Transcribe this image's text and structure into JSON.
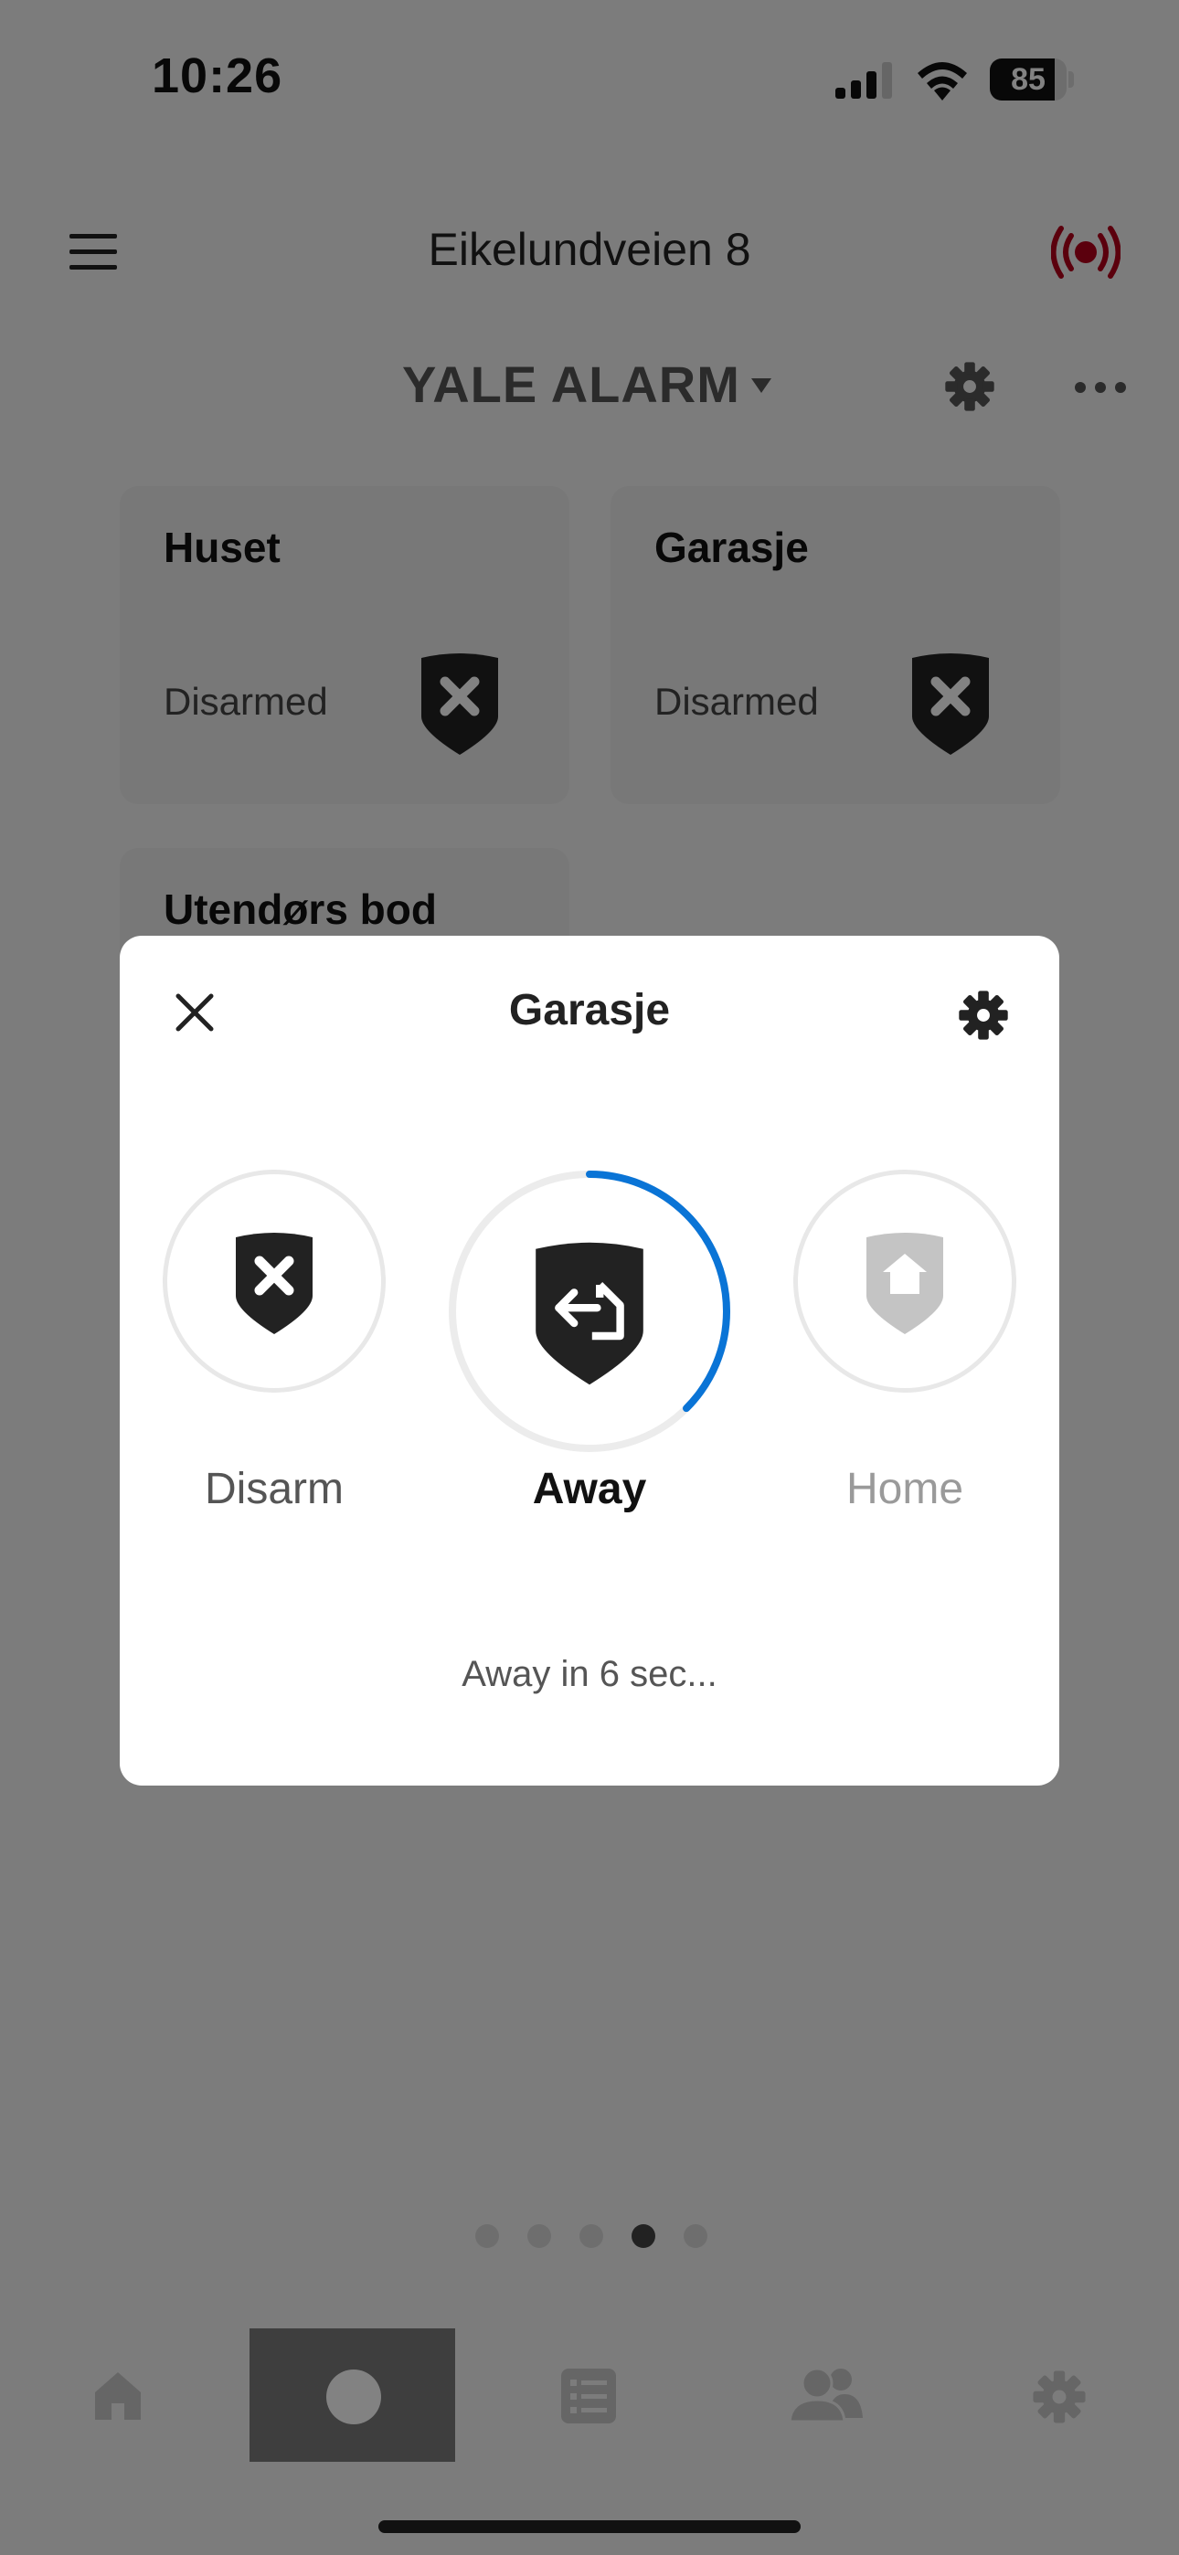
{
  "status_bar": {
    "time": "10:26",
    "battery_percent": "85",
    "battery_level": 0.85
  },
  "header": {
    "location": "Eikelundveien 8"
  },
  "system": {
    "title": "YALE ALARM"
  },
  "areas": [
    {
      "name": "Huset",
      "status": "Disarmed"
    },
    {
      "name": "Garasje",
      "status": "Disarmed"
    },
    {
      "name": "Utendørs bod"
    }
  ],
  "modal": {
    "title": "Garasje",
    "modes": [
      {
        "label": "Disarm",
        "icon": "shield-x-icon",
        "state": "normal"
      },
      {
        "label": "Away",
        "icon": "shield-away-icon",
        "state": "selected",
        "progress": 0.375
      },
      {
        "label": "Home",
        "icon": "shield-home-icon",
        "state": "disabled"
      }
    ],
    "countdown": "Away in 6 sec..."
  },
  "pager": {
    "count": 5,
    "active_index": 3
  },
  "bottom_nav": {
    "active_index": 1,
    "items": [
      {
        "icon": "home-icon"
      },
      {
        "icon": "alarm-icon"
      },
      {
        "icon": "list-icon"
      },
      {
        "icon": "users-icon"
      },
      {
        "icon": "settings-icon"
      }
    ]
  },
  "colors": {
    "accent_blue": "#0a74d6",
    "alarm_red": "#b3001b",
    "shield_dark": "#222222",
    "shield_disabled": "#c4c4c4",
    "label_disabled": "#9a9a9a"
  }
}
